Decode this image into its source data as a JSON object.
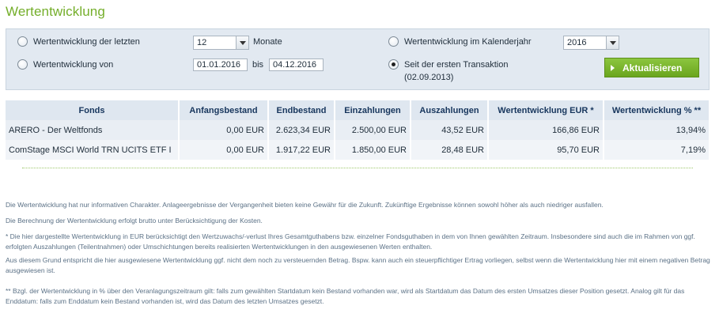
{
  "page": {
    "title": "Wertentwicklung"
  },
  "filters": {
    "last_period": {
      "label": "Wertentwicklung der letzten",
      "value": "12",
      "unit": "Monate",
      "checked": false
    },
    "calendar_year": {
      "label": "Wertentwicklung im Kalenderjahr",
      "value": "2016",
      "checked": false
    },
    "date_range": {
      "label": "Wertentwicklung von",
      "from": "01.01.2016",
      "separator": "bis",
      "to": "04.12.2016",
      "checked": false
    },
    "since_first": {
      "label": "Seit der ersten Transaktion",
      "date": "(02.09.2013)",
      "checked": true
    },
    "update_button": "Aktualisieren"
  },
  "table": {
    "headers": [
      "Fonds",
      "Anfangsbestand",
      "Endbestand",
      "Einzahlungen",
      "Auszahlungen",
      "Wertentwicklung EUR *",
      "Wertentwicklung % **"
    ],
    "rows": [
      [
        "ARERO - Der Weltfonds",
        "0,00 EUR",
        "2.623,34 EUR",
        "2.500,00 EUR",
        "43,52 EUR",
        "166,86 EUR",
        "13,94%"
      ],
      [
        "ComStage MSCI World TRN UCITS ETF I",
        "0,00 EUR",
        "1.917,22 EUR",
        "1.850,00 EUR",
        "28,48 EUR",
        "95,70 EUR",
        "7,19%"
      ]
    ]
  },
  "notes": {
    "n1": "Die Wertentwicklung hat nur informativen Charakter. Anlageergebnisse der Vergangenheit bieten keine Gewähr für die Zukunft. Zukünftige Ergebnisse können sowohl höher als auch niedriger ausfallen.",
    "n2": "Die Berechnung der Wertentwicklung erfolgt brutto unter Berücksichtigung der Kosten.",
    "n3a": "* Die hier dargestellte Wertentwicklung in EUR berücksichtigt den Wertzuwachs/-verlust Ihres Gesamtguthabens bzw. einzelner Fondsguthaben in dem von Ihnen gewählten Zeitraum. Insbesondere sind auch die im Rahmen von ggf. erfolgten Auszahlungen (Teilentnahmen) oder Umschichtungen bereits realisierten Wertentwicklungen in den ausgewiesenen Werten enthalten.",
    "n3b": "Aus diesem Grund entspricht die hier ausgewiesene Wertentwicklung ggf. nicht dem noch zu versteuernden Betrag. Bspw. kann auch ein steuerpflichtiger Ertrag vorliegen, selbst wenn die Wertentwicklung hier mit einem negativen Betrag ausgewiesen ist.",
    "n4": "** Bzgl. der Wertentwicklung in % über den Veranlagungszeitraum gilt: falls zum gewählten Startdatum kein Bestand vorhanden war, wird als Startdatum das Datum des ersten Umsatzes dieser Position gesetzt. Analog gilt für das Enddatum: falls zum Enddatum kein Bestand vorhanden ist, wird das Datum des letzten Umsatzes gesetzt."
  }
}
